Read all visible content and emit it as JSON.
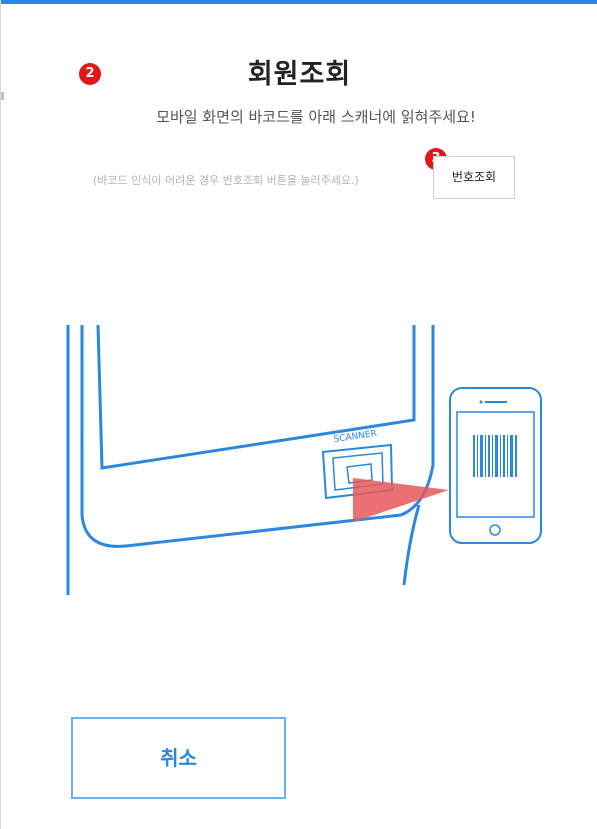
{
  "page": {
    "title": "회원조회",
    "subtitle": "모바일 화면의 바코드를 아래 스캐너에 읽혀주세요!",
    "hint": "(바코드 인식이 어려운 경우 번호조회 버튼을 눌러주세요.)"
  },
  "markers": {
    "title_marker": "2",
    "button_marker": "3"
  },
  "buttons": {
    "lookup_label": "번호조회",
    "cancel_label": "취소"
  },
  "illustration": {
    "scanner_label": "SCANNER"
  },
  "colors": {
    "accent": "#2b88e0",
    "marker": "#e3161a",
    "beam": "#e8575a"
  },
  "icons": [
    "barcode-icon",
    "smartphone-icon",
    "scanner-icon"
  ]
}
